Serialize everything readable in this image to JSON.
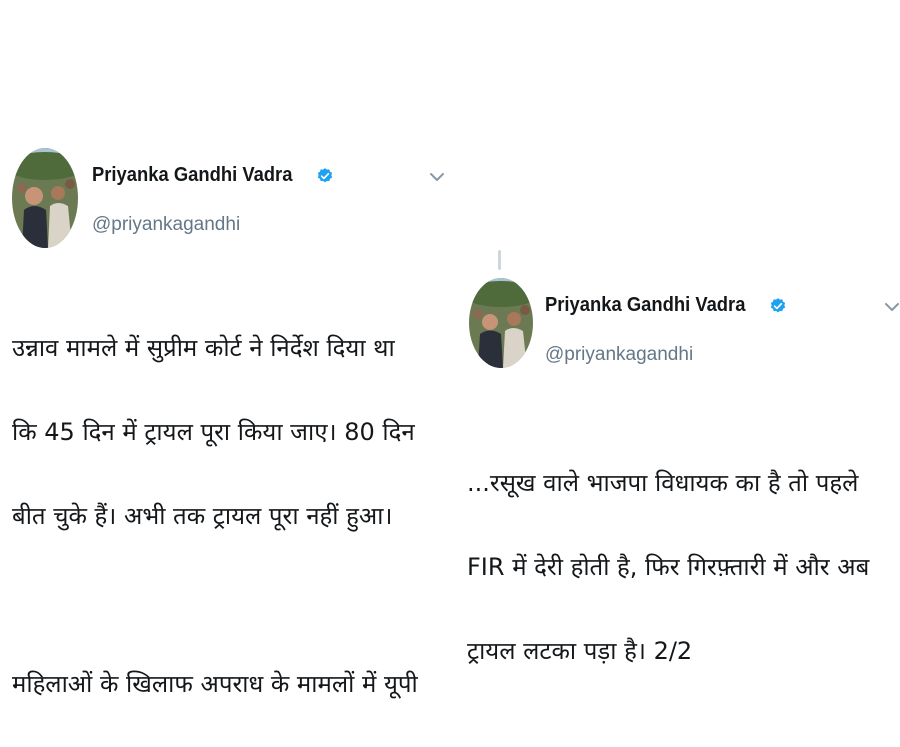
{
  "tweets": [
    {
      "author": {
        "display_name": "Priyanka Gandhi Vadra",
        "handle": "@priyankagandhi",
        "verified": true,
        "avatar_icon": "profile-photo"
      },
      "menu_icon": "chevron-down-icon",
      "body_lines": [
        "उन्नाव मामले में सुप्रीम कोर्ट ने निर्देश दिया था",
        "कि 45 दिन में ट्रायल पूरा किया जाए। 80 दिन",
        "बीत चुके हैं। अभी तक ट्रायल पूरा नहीं हुआ।",
        "",
        "महिलाओं के खिलाफ अपराध के मामलों में यूपी"
      ]
    },
    {
      "author": {
        "display_name": "Priyanka Gandhi Vadra",
        "handle": "@priyankagandhi",
        "verified": true,
        "avatar_icon": "profile-photo"
      },
      "menu_icon": "chevron-down-icon",
      "body_lines": [
        "...रसूख वाले भाजपा विधायक का है तो पहले",
        "FIR में देरी होती है, फिर गिरफ़्तारी में और अब",
        "ट्रायल लटका पड़ा है। 2/2"
      ]
    }
  ],
  "colors": {
    "text_primary": "#14171a",
    "text_secondary": "#657786",
    "verified_blue": "#1da1f2",
    "background": "#ffffff"
  }
}
